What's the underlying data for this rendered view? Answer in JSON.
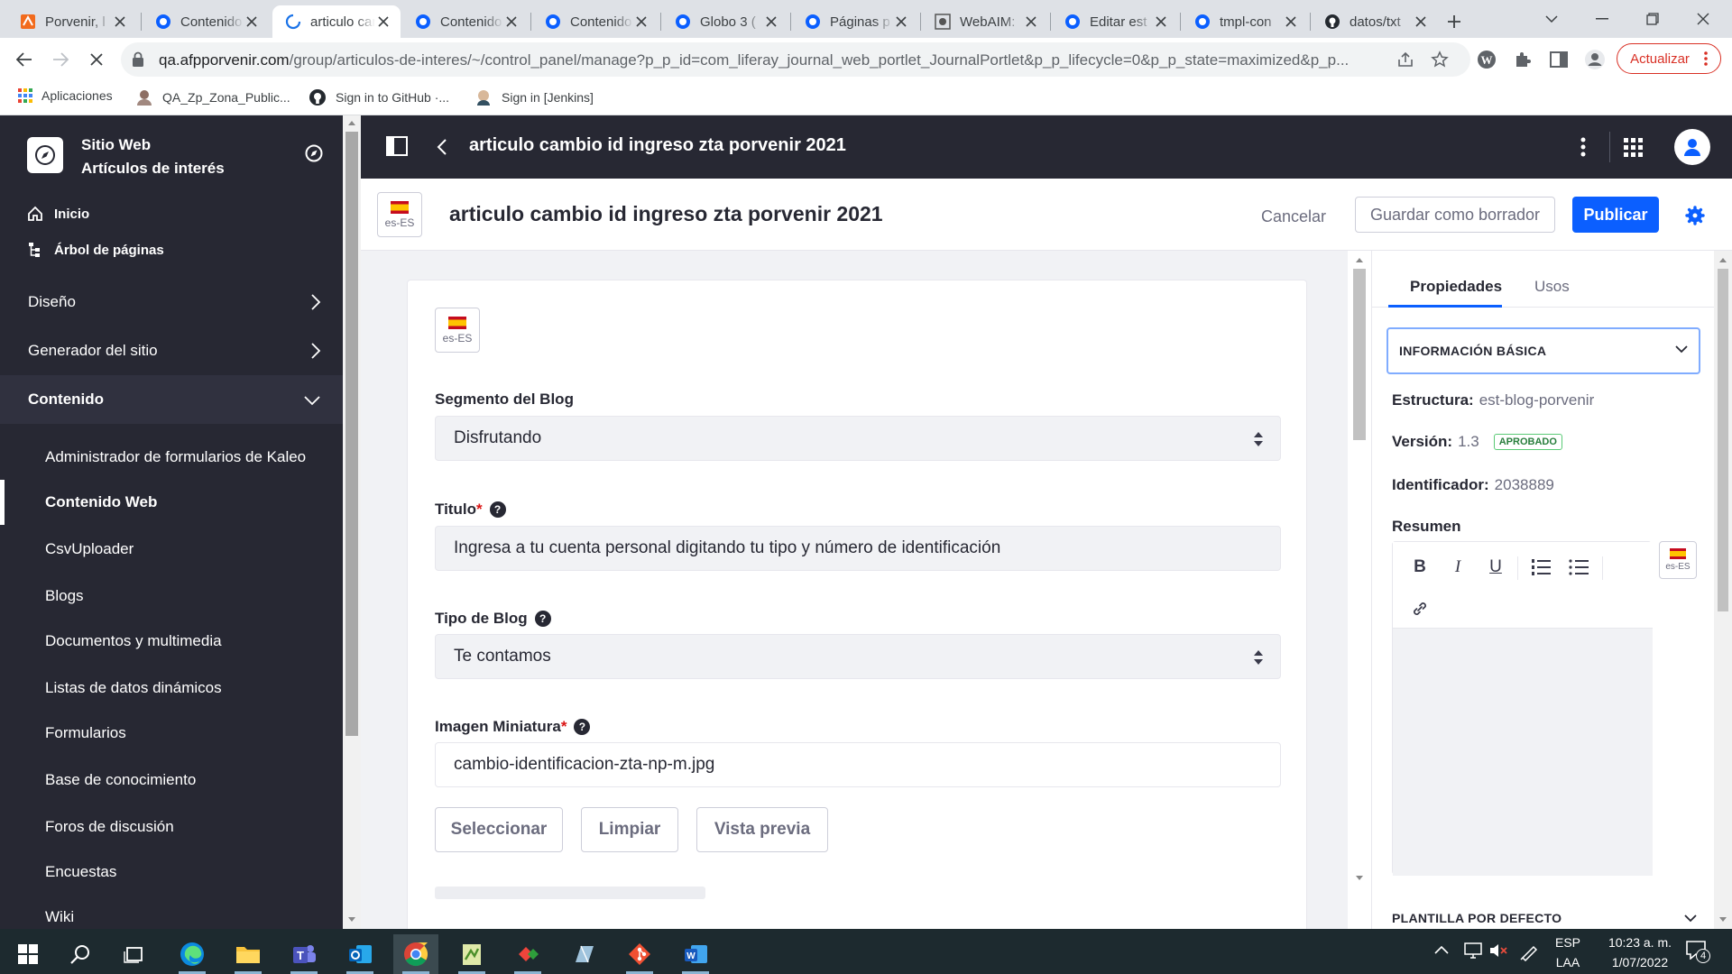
{
  "browser": {
    "tabs": [
      {
        "title": "Porvenir, l",
        "icon": "porvenir-favicon"
      },
      {
        "title": "Contenido",
        "icon": "liferay-favicon"
      },
      {
        "title": "articulo cambio",
        "icon": "loading-spinner",
        "active": true
      },
      {
        "title": "Contenido",
        "icon": "liferay-favicon"
      },
      {
        "title": "Contenido",
        "icon": "liferay-favicon"
      },
      {
        "title": "Globo 3 (",
        "icon": "liferay-favicon"
      },
      {
        "title": "Páginas p",
        "icon": "liferay-favicon"
      },
      {
        "title": "WebAIM:",
        "icon": "webaim-favicon"
      },
      {
        "title": "Editar est",
        "icon": "liferay-favicon"
      },
      {
        "title": "tmpl-con",
        "icon": "liferay-favicon"
      },
      {
        "title": "datos/txt",
        "icon": "github-favicon"
      }
    ],
    "url_host": "qa.afpporvenir.com",
    "url_path": "/group/articulos-de-interes/~/control_panel/manage?p_p_id=com_liferay_journal_web_portlet_JournalPortlet&p_p_lifecycle=0&p_p_state=maximized&p_p...",
    "update_label": "Actualizar",
    "bookmarks": [
      {
        "label": "Aplicaciones",
        "icon": "apps-grid-icon"
      },
      {
        "label": "QA_Zp_Zona_Public...",
        "icon": "avatar-icon"
      },
      {
        "label": "Sign in to GitHub ·...",
        "icon": "github-icon"
      },
      {
        "label": "Sign in [Jenkins]",
        "icon": "jenkins-icon"
      }
    ]
  },
  "sidebar": {
    "site_line1": "Sitio Web",
    "site_line2": "Artículos de interés",
    "top_items": [
      {
        "label": "Inicio",
        "icon": "home-icon"
      },
      {
        "label": "Árbol de páginas",
        "icon": "page-tree-icon"
      }
    ],
    "sections": [
      {
        "label": "Diseño",
        "open": false
      },
      {
        "label": "Generador del sitio",
        "open": false
      },
      {
        "label": "Contenido",
        "open": true
      }
    ],
    "sub_items": [
      "Administrador de formularios de Kaleo",
      "Contenido Web",
      "CsvUploader",
      "Blogs",
      "Documentos y multimedia",
      "Listas de datos dinámicos",
      "Formularios",
      "Base de conocimiento",
      "Foros de discusión",
      "Encuestas",
      "Wiki"
    ],
    "active_sub": "Contenido Web"
  },
  "appbar": {
    "title": "articulo cambio id ingreso zta porvenir 2021"
  },
  "editbar": {
    "locale": "es-ES",
    "title": "articulo cambio id ingreso zta porvenir 2021",
    "cancel": "Cancelar",
    "save_draft": "Guardar como borrador",
    "publish": "Publicar"
  },
  "form": {
    "locale": "es-ES",
    "segment_label": "Segmento del Blog",
    "segment_value": "Disfrutando",
    "title_label": "Titulo",
    "title_value": "Ingresa a tu cuenta personal digitando tu tipo y número de identificación",
    "type_label": "Tipo de Blog",
    "type_value": "Te contamos",
    "thumb_label": "Imagen Miniatura",
    "thumb_value": "cambio-identificacion-zta-np-m.jpg",
    "btn_select": "Seleccionar",
    "btn_clear": "Limpiar",
    "btn_preview": "Vista previa",
    "required_mark": "*",
    "help_glyph": "?"
  },
  "panel": {
    "tab_props": "Propiedades",
    "tab_uses": "Usos",
    "section": "INFORMACIÓN BÁSICA",
    "structure_label": "Estructura:",
    "structure_value": "est-blog-porvenir",
    "version_label": "Versión:",
    "version_value": "1.3",
    "status": "APROBADO",
    "id_label": "Identificador:",
    "id_value": "2038889",
    "summary_label": "Resumen",
    "summary_locale": "es-ES",
    "bold_glyph": "B",
    "italic_glyph": "I",
    "underline_glyph": "U",
    "next_section": "PLANTILLA POR DEFECTO"
  },
  "taskbar": {
    "lang1": "ESP",
    "lang2": "LAA",
    "time": "10:23 a. m.",
    "date": "1/07/2022",
    "notif_count": "4"
  },
  "colors": {
    "primary": "#0b5fff",
    "sidebar_bg": "#272833",
    "required": "#da1414",
    "approved": "#287d3c"
  }
}
